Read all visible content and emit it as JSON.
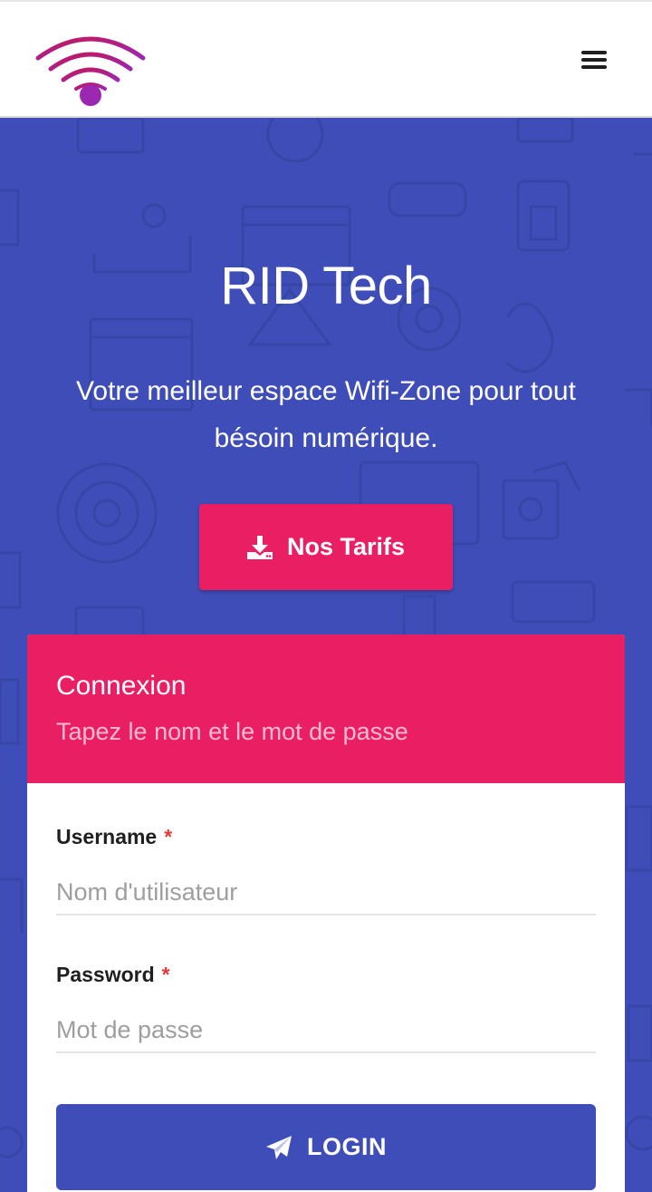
{
  "header": {
    "logo_icon": "wifi-logo-icon",
    "menu_icon": "hamburger-menu-icon"
  },
  "hero": {
    "title": "RID Tech",
    "subtitle": "Votre meilleur espace Wifi-Zone pour tout bésoin numérique.",
    "tarifs_button": {
      "label": "Nos Tarifs",
      "icon": "download-icon"
    }
  },
  "login_card": {
    "title": "Connexion",
    "subtitle": "Tapez le nom et le mot de passe",
    "username": {
      "label": "Username",
      "required_mark": "*",
      "placeholder": "Nom d'utilisateur",
      "value": ""
    },
    "password": {
      "label": "Password",
      "required_mark": "*",
      "placeholder": "Mot de passe",
      "value": ""
    },
    "login_button": {
      "label": "LOGIN",
      "icon": "paper-plane-icon"
    }
  },
  "colors": {
    "primary_blue": "#3f4db8",
    "accent_pink": "#e91e63",
    "logo_gradient_start": "#c2185b",
    "logo_gradient_end": "#9c27b0"
  }
}
